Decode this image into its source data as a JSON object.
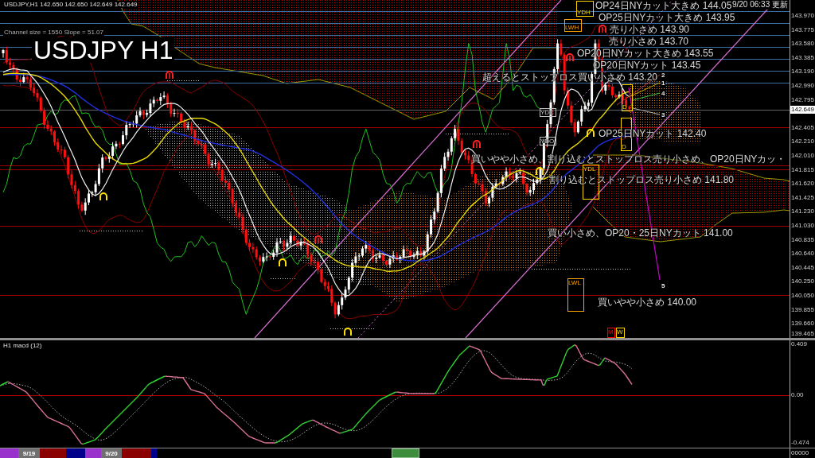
{
  "header": {
    "symbol_quote": "USDJPY,H1  142.650 142.650 142.649 142.649",
    "channel_info": "Channel size = 1550 Slope = 51.07",
    "title": "USDJPY H1",
    "updated": "9/20 06:33 更新"
  },
  "annotations": [
    "OP24日NYカット大きめ 144.05",
    "OP25日NYカット大きめ 143.95",
    "売り小さめ 143.90",
    "売り小さめ 143.70",
    "OP20日NYカット大きめ 143.55",
    "OP20日NYカット 143.45",
    "超えるとストップロス買い小さめ 143.20",
    "OP25日NYカット 142.40",
    "買いやや小さめ、割り込むとストップロス売り小さめ、OP20日NYカッ・",
    "割り込むとストップロス売り小さめ 141.80",
    "買い小さめ、OP20・25日NYカット 141.00",
    "買いやや小さめ 140.00"
  ],
  "wave_labels": [
    "2",
    "1",
    "4",
    "3",
    "5"
  ],
  "range_boxes": [
    {
      "label": "YDH",
      "color": "#ffd700"
    },
    {
      "label": "LWH",
      "color": "#ffa500"
    },
    {
      "label": "D",
      "color": "#ffd700"
    },
    {
      "label": "YDC",
      "color": "#c0c0c0"
    },
    {
      "label": "D",
      "color": "#ffd700"
    },
    {
      "label": "YDO",
      "color": "#c0c0c0"
    },
    {
      "label": "YDL",
      "color": "#ffd700"
    },
    {
      "label": "LWL",
      "color": "#ffa500"
    },
    {
      "label": "M",
      "color": "#ff0000"
    },
    {
      "label": "W",
      "color": "#ffd700"
    }
  ],
  "price_axis": {
    "labels": [
      "143.970",
      "143.775",
      "143.580",
      "143.385",
      "143.190",
      "142.990",
      "142.795",
      "142.405",
      "142.210",
      "142.010",
      "141.815",
      "141.620",
      "141.425",
      "141.230",
      "141.030",
      "140.835",
      "140.640",
      "140.445",
      "140.250",
      "140.050",
      "139.855",
      "139.660",
      "139.465"
    ],
    "current_price": "142.649"
  },
  "macd_pane": {
    "title": "H1  macd (12)",
    "axis_labels": [
      "0.409",
      "0.00",
      "-0.474"
    ]
  },
  "time_bar": {
    "segments": [
      {
        "color": "#9932cc"
      },
      {
        "label": "9/19",
        "color": "#707070"
      },
      {
        "color": "#8b0000"
      },
      {
        "color": "#00008b"
      },
      {
        "color": "#9932cc"
      },
      {
        "label": "9/20",
        "color": "#707070"
      },
      {
        "color": "#8b0000"
      },
      {
        "color": "#00008b"
      }
    ],
    "corner": "00000"
  }
}
